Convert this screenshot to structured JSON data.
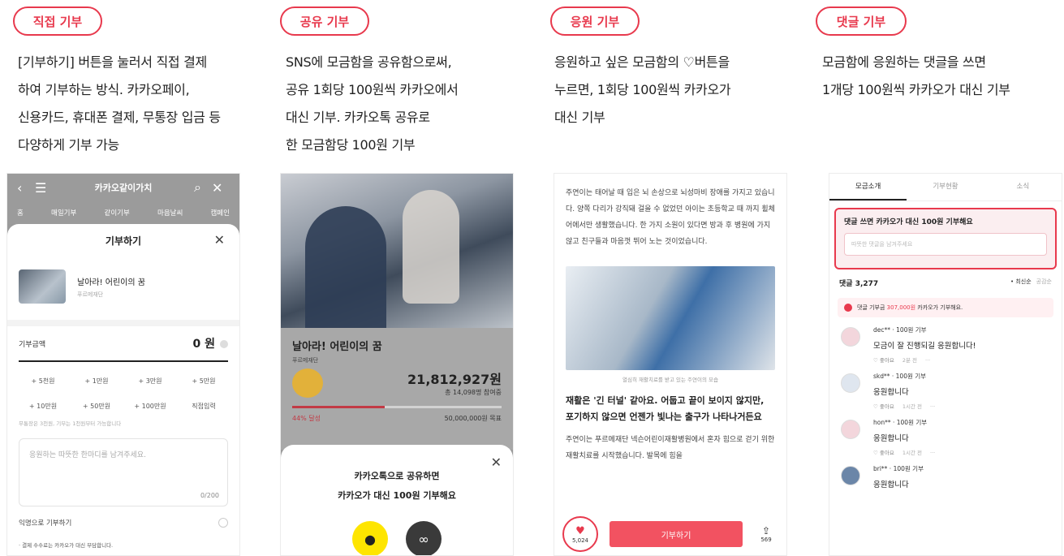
{
  "columns": [
    {
      "tag": "직접 기부",
      "lines": [
        "[기부하기] 버튼을 눌러서 직접 결제",
        "하여 기부하는 방식. 카카오페이,",
        "신용카드, 휴대폰 결제, 무통장 입금 등",
        "다양하게 기부 가능"
      ]
    },
    {
      "tag": "공유 기부",
      "lines": [
        "SNS에 모금함을 공유함으로써,",
        "공유 1회당 100원씩 카카오에서",
        "대신 기부. 카카오톡 공유로",
        "한 모금함당 100원 기부"
      ]
    },
    {
      "tag": "응원 기부",
      "lines": [
        "응원하고 싶은 모금함의 ♡버튼을",
        "누르면, 1회당 100원씩 카카오가",
        "대신 기부"
      ]
    },
    {
      "tag": "댓글 기부",
      "lines": [
        "모금함에 응원하는 댓글을 쓰면",
        "1개당 100원씩 카카오가 대신 기부"
      ]
    }
  ],
  "phone1": {
    "title": "카카오같이가치",
    "nav": [
      "홈",
      "매일기부",
      "같이기부",
      "마음날씨",
      "캠페인"
    ],
    "sheet_title": "기부하기",
    "project_name": "날아라! 어린이의 꿈",
    "project_org": "푸르메재단",
    "amount_label": "기부금액",
    "amount_value": "0 원",
    "chips": [
      "+ 5천원",
      "+ 1만원",
      "+ 3만원",
      "+ 5만원",
      "+ 10만원",
      "+ 50만원",
      "+ 100만원",
      "직접입력"
    ],
    "min_note": "무통장은 3천원, 기부는 1천원부터 가능합니다",
    "msg_placeholder": "응원하는 따뜻한 한마디를 남겨주세요.",
    "msg_count": "0/200",
    "anon_label": "익명으로 기부하기",
    "fee_note": "· 결제 수수료는 카카오가 대신 부담합니다."
  },
  "phone2": {
    "title": "날아라! 어린이의 꿈",
    "org": "푸르메재단",
    "sum": "21,812,927원",
    "participants": "총 14,098명 참여중",
    "progress": 0.44,
    "pct": "44% 달성",
    "goal": "50,000,000원 목표",
    "share_line1": "카카오톡으로 공유하면",
    "share_line2": "카카오가 대신 100원 기부해요"
  },
  "phone3": {
    "body": "주연이는 태어날 때 입은 뇌 손상으로 뇌성마비 장애를 가지고 있습니다. 양쪽 다리가 강직돼 걸을 수 없었던 아이는 초등학교 때 까지 휠체어에서만 생활했습니다. 한 가지 소원이 있다면 방과 후 병원에 가지 않고 친구들과 마음껏 뛰어 노는 것이었습니다.",
    "caption": "열심히 재활치료를 받고 있는 주연이의 모습",
    "heading": "재활은 '긴 터널' 같아요. 어둡고 끝이 보이지 않지만, 포기하지 않으면 언젠가 빛나는 출구가 나타나거든요",
    "body2": "주연이는 푸르메재단 넥슨어린이재활병원에서 혼자 힘으로 걷기 위한 재활치료를 시작했습니다. 발목에 힘을",
    "likes": "5,024",
    "give_label": "기부하기",
    "shares": "569"
  },
  "phone4": {
    "tabs": [
      "모금소개",
      "기부현황",
      "소식"
    ],
    "box_title": "댓글 쓰면 카카오가 대신 100원 기부해요",
    "box_placeholder": "따뜻한 댓글을 남겨주세요",
    "count": "댓글 3,277",
    "sort_active": "• 최신순",
    "sort_other": "공감순",
    "banner_pre": "댓글 기부금 ",
    "banner_hl": "307,000원",
    "banner_post": " 카카오가 기부해요.",
    "comments": [
      {
        "user": "dec** · 100원 기부",
        "text": "모금이 잘 진행되길 응원합니다!",
        "like": "♡ 좋아요",
        "time": "2분 전",
        "more": "···"
      },
      {
        "user": "skd** · 100원 기부",
        "text": "응원합니다",
        "like": "♡ 좋아요",
        "time": "1시간 전",
        "more": "···"
      },
      {
        "user": "hon** · 100원 기부",
        "text": "응원합니다",
        "like": "♡ 좋아요",
        "time": "1시간 전",
        "more": "···"
      },
      {
        "user": "bri** · 100원 기부",
        "text": "응원합니다",
        "like": "",
        "time": "",
        "more": ""
      }
    ]
  }
}
